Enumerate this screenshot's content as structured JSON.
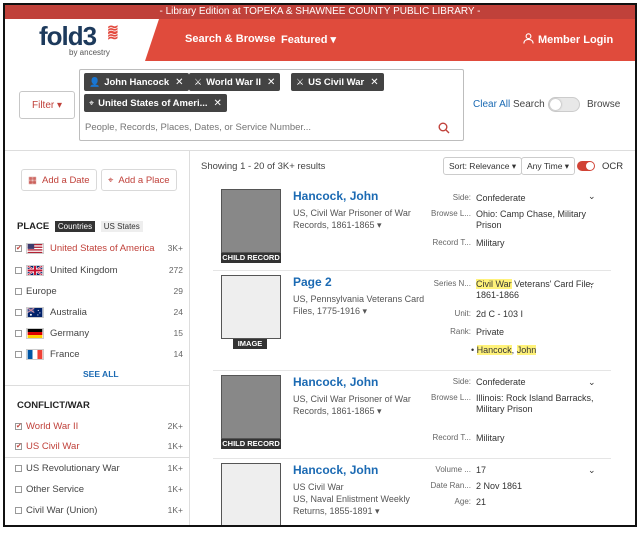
{
  "banner": "- Library Edition at TOPEKA & SHAWNEE COUNTY PUBLIC LIBRARY -",
  "logo": {
    "text": "fold3",
    "byline": "by ancestry"
  },
  "nav": {
    "search_browse": "Search & Browse",
    "featured": "Featured ▾",
    "login": "Member Login"
  },
  "filter": {
    "button": "Filter ▾",
    "chips": [
      {
        "icon": "person-icon",
        "label": "John Hancock"
      },
      {
        "icon": "swords-icon",
        "label": "World War II"
      },
      {
        "icon": "swords-icon",
        "label": "US Civil War"
      },
      {
        "icon": "location-icon",
        "label": "United States of Ameri..."
      }
    ],
    "placeholder": "People, Records, Places, Dates, or Service Number...",
    "clear_all": "Clear All",
    "search_label": "Search",
    "browse_label": "Browse"
  },
  "sidebar": {
    "add_date": "Add a Date",
    "add_place": "Add a Place",
    "place_title": "PLACE",
    "place_tabs": [
      "Countries",
      "US States"
    ],
    "places": [
      {
        "label": "United States of America",
        "count": "3K+",
        "checked": true,
        "flag": "us"
      },
      {
        "label": "United Kingdom",
        "count": "272",
        "checked": false,
        "flag": "uk"
      },
      {
        "label": "Europe",
        "count": "29",
        "checked": false,
        "flag": ""
      },
      {
        "label": "Australia",
        "count": "24",
        "checked": false,
        "flag": "au"
      },
      {
        "label": "Germany",
        "count": "15",
        "checked": false,
        "flag": "de"
      },
      {
        "label": "France",
        "count": "14",
        "checked": false,
        "flag": "fr"
      }
    ],
    "see_all": "SEE ALL",
    "conflict_title": "CONFLICT/WAR",
    "conflicts": [
      {
        "label": "World War II",
        "count": "2K+",
        "checked": true
      },
      {
        "label": "US Civil War",
        "count": "1K+",
        "checked": true
      },
      {
        "label": "US Revolutionary War",
        "count": "1K+",
        "checked": false
      },
      {
        "label": "Other Service",
        "count": "1K+",
        "checked": false
      },
      {
        "label": "Civil War (Union)",
        "count": "1K+",
        "checked": false
      }
    ]
  },
  "results": {
    "count": "Showing 1 - 20 of 3K+ results",
    "sort": "Sort: Relevance ▾",
    "time": "Any Time ▾",
    "ocr": "OCR",
    "records": [
      {
        "title": "Hancock, John",
        "subtitle": "US, Civil War Prisoner of War Records, 1861-1865 ▾",
        "tag": "CHILD RECORD",
        "fields": [
          {
            "k": "Side:",
            "v": "Confederate"
          },
          {
            "k": "Browse L...",
            "v": "Ohio: Camp Chase, Military Prison"
          },
          {
            "k": "Record T...",
            "v": "Military"
          }
        ]
      },
      {
        "title": "Page 2",
        "subtitle": "US, Pennsylvania Veterans Card Files, 1775-1916 ▾",
        "tag": "IMAGE",
        "fields": [
          {
            "k": "Series N...",
            "v_hl": "Civil War",
            "v": " Veterans' Card File, 1861-1866"
          },
          {
            "k": "Unit:",
            "v": "2d C - 103 I"
          },
          {
            "k": "Rank:",
            "v": "Private"
          }
        ],
        "bullet_a": "Hancock",
        "bullet_sep": ", ",
        "bullet_b": "John"
      },
      {
        "title": "Hancock, John",
        "subtitle": "US, Civil War Prisoner of War Records, 1861-1865 ▾",
        "tag": "CHILD RECORD",
        "fields": [
          {
            "k": "Side:",
            "v": "Confederate"
          },
          {
            "k": "Browse L...",
            "v": "Illinois: Rock Island Barracks, Military Prison"
          },
          {
            "k": "Record T...",
            "v": "Military"
          }
        ]
      },
      {
        "title": "Hancock, John",
        "subtitle_line1": "US Civil War",
        "subtitle": "US, Naval Enlistment Weekly Returns, 1855-1891 ▾",
        "fields": [
          {
            "k": "Volume ...",
            "v": "17"
          },
          {
            "k": "Date Ran...",
            "v": "2 Nov 1861"
          },
          {
            "k": "Age:",
            "v": "21"
          }
        ]
      }
    ]
  },
  "colors": {
    "brand_red": "#e04b3c",
    "link_blue": "#1b6ab3",
    "highlight": "#fff27a"
  }
}
